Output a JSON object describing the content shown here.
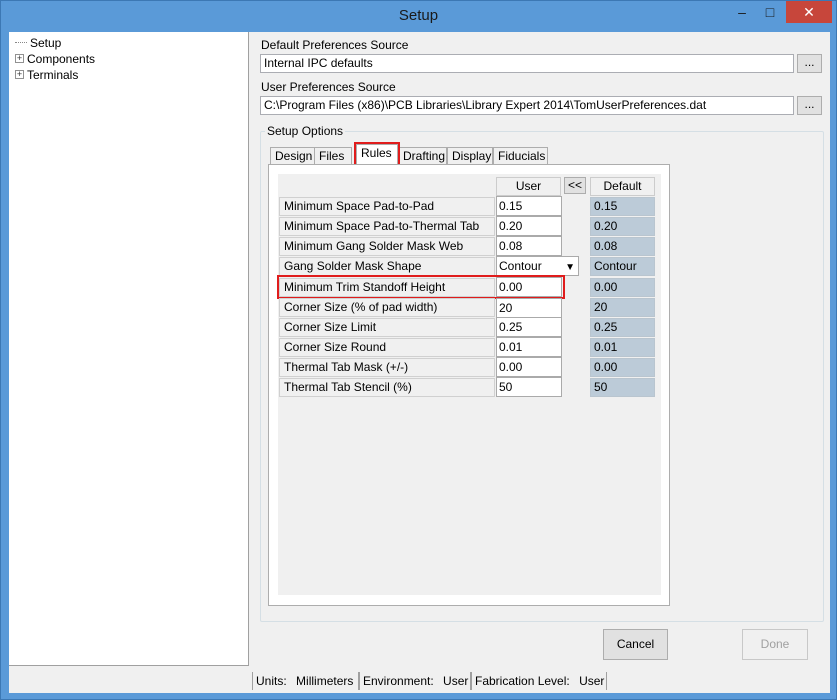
{
  "window": {
    "title": "Setup",
    "minimize_glyph": "–",
    "maximize_glyph": "□",
    "close_glyph": "✕"
  },
  "tree": {
    "items": [
      {
        "label": "Setup",
        "expandable": false
      },
      {
        "label": "Components",
        "expandable": true
      },
      {
        "label": "Terminals",
        "expandable": true
      }
    ]
  },
  "default_prefs": {
    "label": "Default Preferences Source",
    "value": "Internal IPC defaults",
    "browse": "..."
  },
  "user_prefs": {
    "label": "User Preferences Source",
    "value": "C:\\Program Files (x86)\\PCB Libraries\\Library Expert 2014\\TomUserPreferences.dat",
    "browse": "..."
  },
  "setup_options": {
    "label": "Setup Options",
    "tabs": [
      "Design",
      "Files",
      "Rules",
      "Drafting",
      "Display",
      "Fiducials"
    ],
    "active_tab": "Rules"
  },
  "rules": {
    "user_header": "User",
    "copy_button": "<<",
    "default_header": "Default",
    "rows": [
      {
        "label": "Minimum Space Pad-to-Pad",
        "user": "0.15",
        "default": "0.15"
      },
      {
        "label": "Minimum Space Pad-to-Thermal Tab",
        "user": "0.20",
        "default": "0.20"
      },
      {
        "label": "Minimum Gang Solder Mask Web",
        "user": "0.08",
        "default": "0.08"
      },
      {
        "label": "Gang Solder Mask Shape",
        "user": "Contour",
        "default": "Contour"
      },
      {
        "label": "Minimum Trim Standoff Height",
        "user": "0.00",
        "default": "0.00"
      },
      {
        "label": "Corner Size (% of pad width)",
        "user": "20",
        "default": "20"
      },
      {
        "label": "Corner Size Limit",
        "user": "0.25",
        "default": "0.25"
      },
      {
        "label": "Corner Size Round",
        "user": "0.01",
        "default": "0.01"
      },
      {
        "label": "Thermal Tab Mask (+/-)",
        "user": "0.00",
        "default": "0.00"
      },
      {
        "label": "Thermal Tab Stencil (%)",
        "user": "50",
        "default": "50"
      }
    ]
  },
  "buttons": {
    "cancel": "Cancel",
    "done": "Done"
  },
  "status": {
    "units_label": "Units:",
    "units_value": "Millimeters",
    "env_label": "Environment:",
    "env_value": "User",
    "fab_label": "Fabrication Level:",
    "fab_value": "User"
  },
  "colors": {
    "highlight": "#e01c1c",
    "default_cell": "#bccbd8",
    "title_bar": "#5a9ad8",
    "close_button": "#c7463b"
  }
}
